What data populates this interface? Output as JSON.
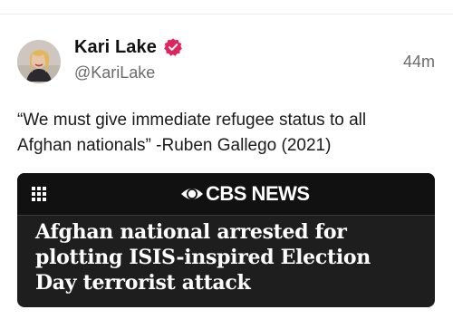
{
  "post": {
    "author": {
      "display_name": "Kari Lake",
      "handle": "@KariLake",
      "verified": true,
      "verified_color": "#e0245e"
    },
    "timestamp": "44m",
    "text": "“We must give immediate refugee status to all\nAfghan nationals” -Ruben Gallego (2021)",
    "link_card": {
      "source": "CBS NEWS",
      "headline": "Afghan national arrested for\nplotting ISIS-inspired Election\nDay terrorist attack",
      "background_color": "#1e1e1e"
    }
  },
  "icons": {
    "verified": "verified-badge-icon",
    "menu": "grid-menu-icon",
    "brand": "cbs-eye-icon"
  }
}
